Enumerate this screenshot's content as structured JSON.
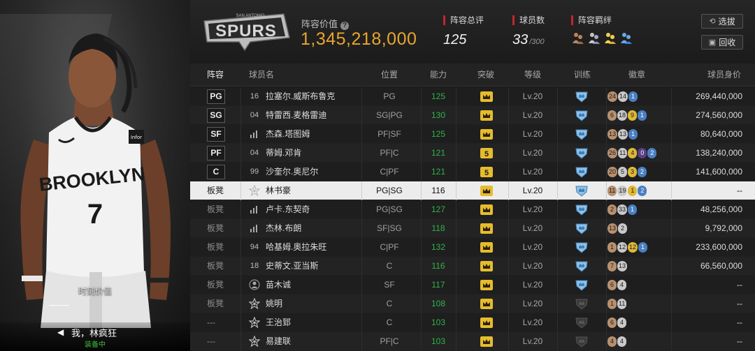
{
  "left_panel": {
    "moment_value_label": "时刻价值",
    "moment_value": "——",
    "motto": "我，林疯狂",
    "motto_arrow": "◀",
    "equipped_label": "装备中",
    "jersey_text": "BROOKLYN",
    "jersey_number": "7"
  },
  "header": {
    "team_logo_text": "SPURS",
    "team_logo_small": "SAN ANTONIO",
    "lineup_value_label": "阵容价值",
    "help_icon_glyph": "?",
    "lineup_value": "1,345,218,000",
    "rating_label": "阵容总评",
    "rating_value": "125",
    "player_count_label": "球员数",
    "player_count": "33",
    "player_count_max": "/300",
    "bond_label": "阵容羁绊",
    "btn_select": "选拔",
    "btn_recycle": "回收",
    "colors": {
      "accent_gold": "#e8a62f",
      "red_marker": "#c0282f"
    }
  },
  "columns": [
    "阵容",
    "球员名",
    "位置",
    "能力",
    "突破",
    "等级",
    "训练",
    "徽章",
    "球员身价"
  ],
  "rows": [
    {
      "slot": "PG",
      "slot_type": "starter",
      "num": "16",
      "num_icon": "",
      "name": "拉塞尔.威斯布鲁克",
      "pos": "PG",
      "ability": "125",
      "breakthrough": "crown",
      "level": "Lv.20",
      "training": "blue",
      "badges": [
        [
          "br",
          "24"
        ],
        [
          "sv",
          "14"
        ],
        [
          "bl",
          "1"
        ]
      ],
      "value": "269,440,000"
    },
    {
      "slot": "SG",
      "slot_type": "starter",
      "num": "04",
      "num_icon": "",
      "name": "特雷西.麦格雷迪",
      "pos": "SG|PG",
      "ability": "130",
      "breakthrough": "crown",
      "level": "Lv.20",
      "training": "blue",
      "badges": [
        [
          "br",
          "6"
        ],
        [
          "sv",
          "18"
        ],
        [
          "gd",
          "9"
        ],
        [
          "bl",
          "1"
        ]
      ],
      "value": "274,560,000"
    },
    {
      "slot": "SF",
      "slot_type": "starter",
      "num": "",
      "num_icon": "bars",
      "name": "杰森.塔图姆",
      "pos": "PF|SF",
      "ability": "125",
      "breakthrough": "crown",
      "level": "Lv.20",
      "training": "blue",
      "badges": [
        [
          "br",
          "13"
        ],
        [
          "sv",
          "13"
        ],
        [
          "bl",
          "1"
        ]
      ],
      "value": "80,640,000"
    },
    {
      "slot": "PF",
      "slot_type": "starter",
      "num": "04",
      "num_icon": "",
      "name": "蒂姆.邓肯",
      "pos": "PF|C",
      "ability": "121",
      "breakthrough": "5",
      "level": "Lv.20",
      "training": "blue",
      "badges": [
        [
          "br",
          "26"
        ],
        [
          "sv",
          "11"
        ],
        [
          "gd",
          "4"
        ],
        [
          "pu",
          "0"
        ],
        [
          "bl",
          "2"
        ]
      ],
      "value": "138,240,000"
    },
    {
      "slot": "C",
      "slot_type": "starter",
      "num": "99",
      "num_icon": "",
      "name": "沙奎尔.奥尼尔",
      "pos": "C|PF",
      "ability": "121",
      "breakthrough": "5",
      "level": "Lv.20",
      "training": "blue",
      "badges": [
        [
          "br",
          "20"
        ],
        [
          "sv",
          "5"
        ],
        [
          "gd",
          "3"
        ],
        [
          "bl",
          "2"
        ]
      ],
      "value": "141,600,000"
    },
    {
      "slot": "板凳",
      "slot_type": "bench",
      "num": "",
      "num_icon": "star",
      "name": "林书豪",
      "pos": "PG|SG",
      "ability": "116",
      "breakthrough": "crown",
      "level": "Lv.20",
      "training": "blue",
      "badges": [
        [
          "br",
          "11"
        ],
        [
          "sv",
          "19"
        ],
        [
          "gd",
          "1"
        ],
        [
          "bl",
          "2"
        ]
      ],
      "value": "--",
      "highlight": true
    },
    {
      "slot": "板凳",
      "slot_type": "bench",
      "num": "",
      "num_icon": "bars",
      "name": "卢卡.东契奇",
      "pos": "PG|SG",
      "ability": "127",
      "breakthrough": "crown",
      "level": "Lv.20",
      "training": "blue",
      "badges": [
        [
          "br",
          "2"
        ],
        [
          "sv",
          "33"
        ],
        [
          "bl",
          "1"
        ]
      ],
      "value": "48,256,000"
    },
    {
      "slot": "板凳",
      "slot_type": "bench",
      "num": "",
      "num_icon": "bars",
      "name": "杰林.布朗",
      "pos": "SF|SG",
      "ability": "118",
      "breakthrough": "crown",
      "level": "Lv.20",
      "training": "blue",
      "badges": [
        [
          "br",
          "13"
        ],
        [
          "sv",
          "2"
        ]
      ],
      "value": "9,792,000"
    },
    {
      "slot": "板凳",
      "slot_type": "bench",
      "num": "94",
      "num_icon": "",
      "name": "哈基姆.奥拉朱旺",
      "pos": "C|PF",
      "ability": "132",
      "breakthrough": "crown",
      "level": "Lv.20",
      "training": "blue",
      "badges": [
        [
          "br",
          "1"
        ],
        [
          "sv",
          "12"
        ],
        [
          "gd",
          "12"
        ],
        [
          "bl",
          "1"
        ]
      ],
      "value": "233,600,000"
    },
    {
      "slot": "板凳",
      "slot_type": "bench",
      "num": "18",
      "num_icon": "",
      "name": "史蒂文.亚当斯",
      "pos": "C",
      "ability": "116",
      "breakthrough": "crown",
      "level": "Lv.20",
      "training": "blue",
      "badges": [
        [
          "br",
          "7"
        ],
        [
          "sv",
          "13"
        ]
      ],
      "value": "66,560,000"
    },
    {
      "slot": "板凳",
      "slot_type": "bench",
      "num": "",
      "num_icon": "person",
      "name": "苗木诚",
      "pos": "SF",
      "ability": "117",
      "breakthrough": "crown",
      "level": "Lv.20",
      "training": "blue",
      "badges": [
        [
          "br",
          "6"
        ],
        [
          "sv",
          "4"
        ]
      ],
      "value": "--"
    },
    {
      "slot": "板凳",
      "slot_type": "bench",
      "num": "",
      "num_icon": "star",
      "name": "姚明",
      "pos": "C",
      "ability": "108",
      "breakthrough": "crown",
      "level": "Lv.20",
      "training": "gray",
      "badges": [
        [
          "br",
          "1"
        ],
        [
          "sv",
          "11"
        ]
      ],
      "value": "--"
    },
    {
      "slot": "---",
      "slot_type": "bench",
      "num": "",
      "num_icon": "star",
      "name": "王治郅",
      "pos": "C",
      "ability": "103",
      "breakthrough": "crown",
      "level": "Lv.20",
      "training": "gray",
      "badges": [
        [
          "br",
          "6"
        ],
        [
          "sv",
          "4"
        ]
      ],
      "value": "--"
    },
    {
      "slot": "---",
      "slot_type": "bench",
      "num": "",
      "num_icon": "star",
      "name": "易建联",
      "pos": "PF|C",
      "ability": "103",
      "breakthrough": "crown",
      "level": "Lv.20",
      "training": "gray",
      "badges": [
        [
          "br",
          "4"
        ],
        [
          "sv",
          "4"
        ]
      ],
      "value": "--"
    }
  ]
}
